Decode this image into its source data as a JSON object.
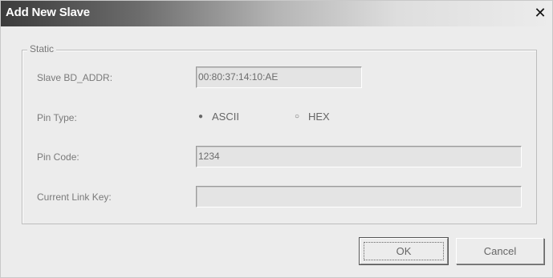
{
  "window": {
    "title": "Add New Slave",
    "close_glyph": "✕"
  },
  "group": {
    "legend": "Static"
  },
  "fields": {
    "slave_bd_addr": {
      "label": "Slave BD_ADDR:",
      "value": "00:80:37:14:10:AE"
    },
    "pin_type": {
      "label": "Pin Type:",
      "options": [
        {
          "label": "ASCII",
          "selected": true
        },
        {
          "label": "HEX",
          "selected": false
        }
      ]
    },
    "pin_code": {
      "label": "Pin Code:",
      "value": "1234"
    },
    "current_link_key": {
      "label": "Current Link Key:",
      "value": ""
    }
  },
  "buttons": {
    "ok": "OK",
    "cancel": "Cancel"
  },
  "icons": {
    "radio_selected": "●",
    "radio_unselected": "○"
  }
}
